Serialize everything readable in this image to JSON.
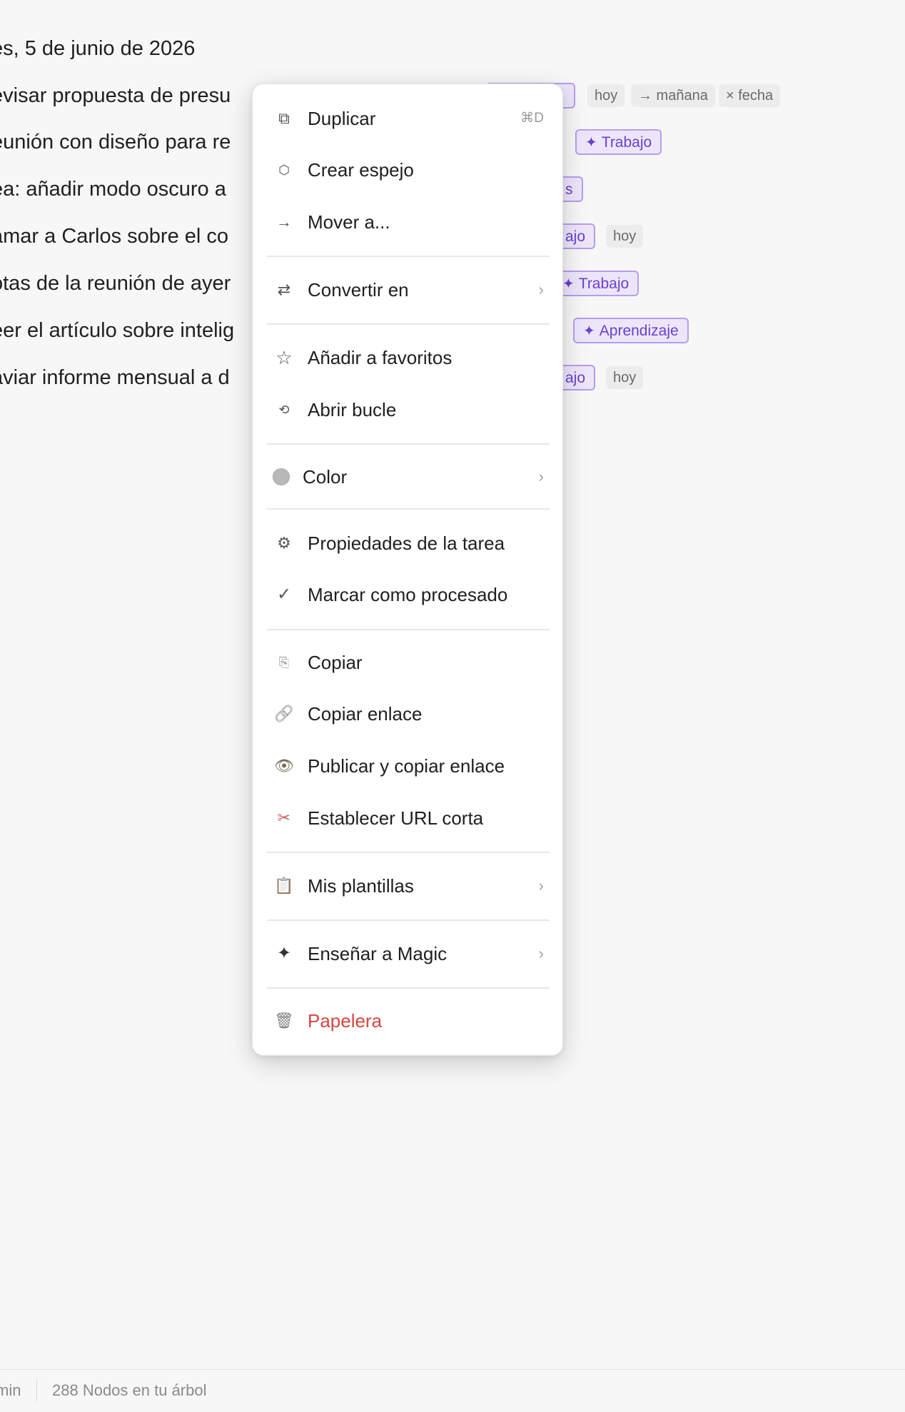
{
  "outline": {
    "date_heading": "es, 5 de junio de 2026",
    "rows": [
      {
        "text": "evisar propuesta de presu",
        "chips": [
          "hoy",
          "→ mañana",
          "× fecha"
        ]
      },
      {
        "text": "eunión con diseño para re",
        "tag": "Trabajo"
      },
      {
        "text": "ea: añadir modo oscuro a",
        "tag_partial": "s"
      },
      {
        "text": "amar a Carlos sobre el co",
        "tag_partial": "ajo",
        "chips": [
          "hoy"
        ]
      },
      {
        "text": "otas de la reunión de ayer",
        "tag_partial_spark": "Trabajo"
      },
      {
        "text": "eer el artículo sobre intelig",
        "tag": "Aprendizaje"
      },
      {
        "text": "aviar informe mensual a d",
        "tag_partial": "ajo",
        "chips": [
          "hoy"
        ]
      }
    ]
  },
  "menu": {
    "items": [
      {
        "label": "Duplicar",
        "icon": "duplicate-icon",
        "glyph": "⧉",
        "shortcut": "⌘D"
      },
      {
        "label": "Crear espejo",
        "icon": "mirror-icon",
        "glyph": "⬡"
      },
      {
        "label": "Mover a...",
        "icon": "arrow-right-icon",
        "glyph": "→"
      },
      {
        "label": "Convertir en",
        "icon": "convert-icon",
        "glyph": "⇄",
        "chevron": "›"
      },
      {
        "label": "Añadir a favoritos",
        "icon": "star-icon",
        "glyph": "☆"
      },
      {
        "label": "Abrir bucle",
        "icon": "loop-icon",
        "glyph": "⟲"
      },
      {
        "label": "Color",
        "icon": "color-dot-icon",
        "chevron": "›"
      },
      {
        "label": "Propiedades de la tarea",
        "icon": "gear-icon",
        "glyph": "⚙"
      },
      {
        "label": "Marcar como procesado",
        "icon": "checkmark-icon",
        "glyph": "✓"
      },
      {
        "label": "Copiar",
        "icon": "copy-icon",
        "glyph": "⎘"
      },
      {
        "label": "Copiar enlace",
        "icon": "link-icon",
        "glyph": "🔗"
      },
      {
        "label": "Publicar y copiar enlace",
        "icon": "eye-icon",
        "glyph": "👁"
      },
      {
        "label": "Establecer URL corta",
        "icon": "scissors-icon",
        "glyph": "✂"
      },
      {
        "label": "Mis plantillas",
        "icon": "clipboard-icon",
        "glyph": "📋",
        "chevron": "›"
      },
      {
        "label": "Enseñar a Magic",
        "icon": "sparkle-icon",
        "glyph": "✦",
        "chevron": "›"
      },
      {
        "label": "Papelera",
        "icon": "trash-icon",
        "glyph": "🗑"
      }
    ]
  },
  "status": {
    "left": "min",
    "nodes": "288 Nodos en tu árbol"
  },
  "colors": {
    "tag_bg": "#ede6fb",
    "tag_border": "#b99cf0",
    "tag_text": "#6a3fd1",
    "danger": "#d8453f"
  }
}
